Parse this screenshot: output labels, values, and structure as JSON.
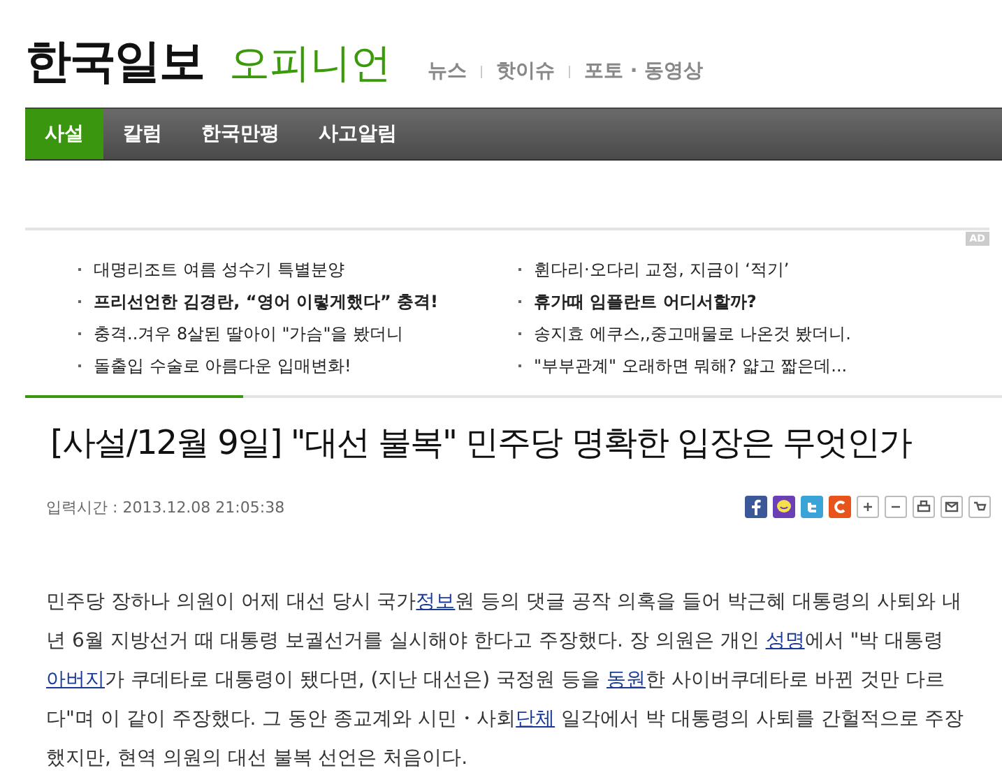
{
  "header": {
    "logo": "한국일보",
    "section": "오피니언",
    "links": [
      "뉴스",
      "핫이슈",
      "포토 · 동영상"
    ]
  },
  "nav": [
    {
      "label": "사설",
      "selected": true
    },
    {
      "label": "칼럼",
      "selected": false
    },
    {
      "label": "한국만평",
      "selected": false
    },
    {
      "label": "사고알림",
      "selected": false
    }
  ],
  "ad": {
    "badge": "AD",
    "columns": [
      [
        {
          "text": "대명리조트 여름 성수기 특별분양",
          "bold": false
        },
        {
          "text": "프리선언한 김경란, “영어 이렇게했다” 충격!",
          "bold": true
        },
        {
          "text": "충격..겨우 8살된 딸아이 \"가슴\"을 봤더니",
          "bold": false
        },
        {
          "text": "돌출입 수술로 아름다운 입매변화!",
          "bold": false
        }
      ],
      [
        {
          "text": "휜다리·오다리 교정, 지금이 ‘적기’",
          "bold": false
        },
        {
          "text": "휴가때 임플란트 어디서할까?",
          "bold": true
        },
        {
          "text": "송지효 에쿠스,,중고매물로 나온것 봤더니.",
          "bold": false
        },
        {
          "text": "\"부부관계\" 오래하면 뭐해? 얇고 짧은데...",
          "bold": false
        }
      ]
    ]
  },
  "article": {
    "title": "[사설/12월 9일] \"대선 불복\" 민주당 명확한 입장은 무엇인가",
    "date": "입력시간 : 2013.12.08 21:05:38",
    "body": [
      {
        "text": "민주당 장하나 의원이 어제 대선 당시 국가",
        "link": false
      },
      {
        "text": "정보",
        "link": true
      },
      {
        "text": "원 등의 댓글 공작 의혹을 들어 박근혜 대통령의 사퇴와 내년 6월 지방선거 때 대통령 보궐선거를 실시해야 한다고 주장했다. 장 의원은 개인 ",
        "link": false
      },
      {
        "text": "성명",
        "link": true
      },
      {
        "text": "에서 \"박 대통령 ",
        "link": false
      },
      {
        "text": "아버지",
        "link": true
      },
      {
        "text": "가 쿠데타로 대통령이 됐다면, (지난 대선은) 국정원 등을 ",
        "link": false
      },
      {
        "text": "동원",
        "link": true
      },
      {
        "text": "한 사이버쿠데타로 바뀐 것만 다르다\"며 이 같이 주장했다. 그 동안 종교계와 시민・사회",
        "link": false
      },
      {
        "text": "단체",
        "link": true
      },
      {
        "text": " 일각에서 박 대통령의 사퇴를 간헐적으로 주장했지만, 현역 의원의 대선 불복 선언은 처음이다.",
        "link": false
      }
    ]
  }
}
